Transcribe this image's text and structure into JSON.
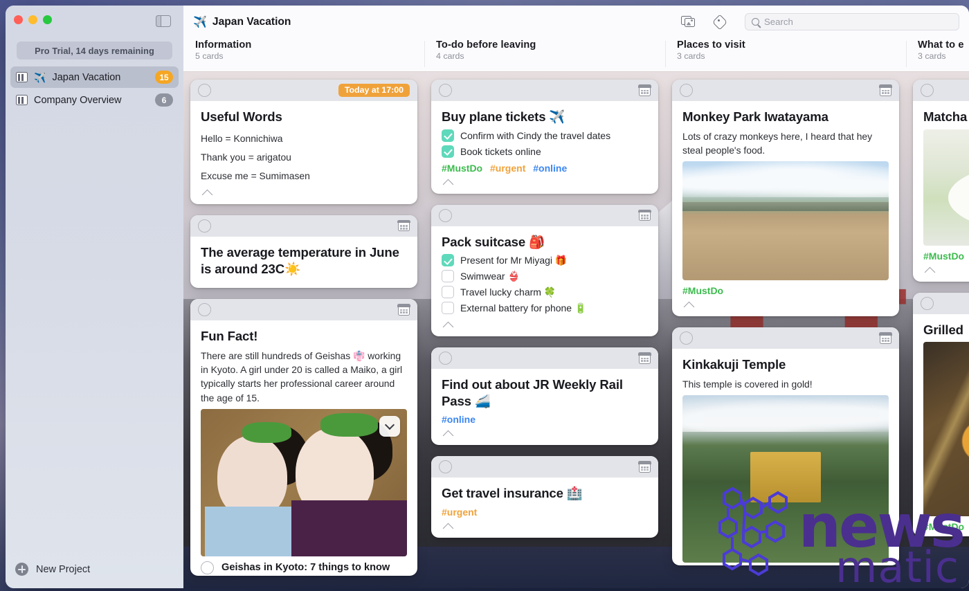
{
  "window": {
    "traffic_lights": [
      "close",
      "minimize",
      "zoom"
    ],
    "sidebar_toggle_icon": "sidebar-toggle-icon",
    "doc_title": "Japan Vacation",
    "doc_title_emoji": "✈️"
  },
  "sidebar": {
    "pro_trial": "Pro Trial, 14 days remaining",
    "projects": [
      {
        "emoji": "✈️",
        "name": "Japan Vacation",
        "count": "15",
        "selected": true,
        "badge_color": "#f5a623"
      },
      {
        "emoji": "",
        "name": "Company Overview",
        "count": "6",
        "selected": false,
        "badge_color": "#8e939f"
      }
    ],
    "new_project_label": "New Project"
  },
  "toolbar": {
    "photos_icon": "photos-icon",
    "tag_icon": "tag-icon",
    "search_placeholder": "Search",
    "search_value": ""
  },
  "columns": [
    {
      "title": "Information",
      "count": "5 cards"
    },
    {
      "title": "To-do before leaving",
      "count": "4 cards"
    },
    {
      "title": "Places to visit",
      "count": "3 cards"
    },
    {
      "title": "What to e",
      "count": "3 cards"
    }
  ],
  "cards": {
    "useful_words": {
      "title": "Useful Words",
      "due_badge": "Today at 17:00",
      "lines": [
        "Hello = Konnichiwa",
        "Thank you = arigatou",
        "Excuse me = Sumimasen"
      ]
    },
    "temperature": {
      "title": "The average temperature in June is around 23C☀️"
    },
    "fun_fact": {
      "title": "Fun Fact!",
      "desc": "There are still hundreds of Geishas 👘 working in Kyoto. A girl under 20 is called a Maiko, a girl typically starts her professional career around the age of 15.",
      "media_caption": "Geishas in Kyoto: 7 things to know"
    },
    "plane_tickets": {
      "title": "Buy plane tickets ✈️",
      "todos": [
        {
          "label": "Confirm with Cindy the travel dates",
          "done": true
        },
        {
          "label": "Book tickets online",
          "done": true
        }
      ],
      "tags": [
        {
          "text": "#MustDo",
          "color": "#3cbb4e"
        },
        {
          "text": "#urgent",
          "color": "#f0a23a"
        },
        {
          "text": "#online",
          "color": "#3b86f0"
        }
      ]
    },
    "pack_suitcase": {
      "title": "Pack suitcase 🎒",
      "todos": [
        {
          "label": "Present for Mr Miyagi 🎁",
          "done": true
        },
        {
          "label": "Swimwear 👙",
          "done": false
        },
        {
          "label": "Travel lucky charm 🍀",
          "done": false
        },
        {
          "label": "External battery for phone 🔋",
          "done": false
        }
      ]
    },
    "rail_pass": {
      "title": "Find out about JR Weekly Rail Pass 🚄",
      "tags": [
        {
          "text": "#online",
          "color": "#3b86f0"
        }
      ]
    },
    "travel_insurance": {
      "title": "Get travel insurance 🏥",
      "tags": [
        {
          "text": "#urgent",
          "color": "#f0a23a"
        }
      ]
    },
    "monkey_park": {
      "title": "Monkey Park Iwatayama",
      "desc": "Lots of crazy monkeys here, I heard that hey steal people's food.",
      "tags": [
        {
          "text": "#MustDo",
          "color": "#3cbb4e"
        }
      ]
    },
    "kinkakuji": {
      "title": "Kinkakuji Temple",
      "desc": "This temple is covered in gold!"
    },
    "matcha": {
      "title": "Matcha",
      "tags": [
        {
          "text": "#MustDo",
          "color": "#3cbb4e"
        }
      ]
    },
    "grilled": {
      "title": "Grilled",
      "tags": [
        {
          "text": "#MustDo",
          "color": "#3cbb4e"
        }
      ]
    }
  },
  "watermark": {
    "primary": "news",
    "secondary": "matic",
    "color": "#4a2f8f"
  }
}
